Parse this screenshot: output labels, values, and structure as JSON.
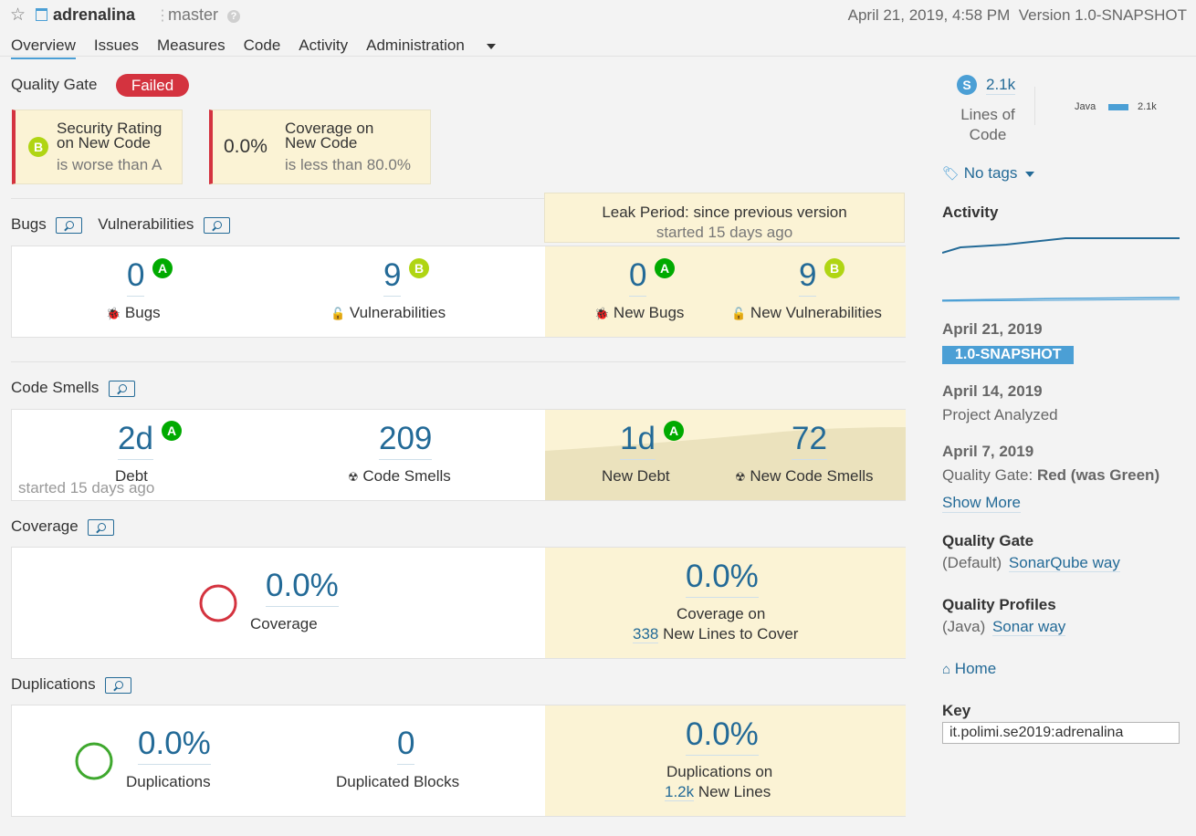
{
  "header": {
    "project_name": "adrenalina",
    "branch": "master",
    "help_glyph": "?",
    "date": "April 21, 2019, 4:58 PM",
    "version": "Version 1.0-SNAPSHOT"
  },
  "nav": {
    "tabs": [
      "Overview",
      "Issues",
      "Measures",
      "Code",
      "Activity",
      "Administration"
    ]
  },
  "quality_gate": {
    "label": "Quality Gate",
    "status": "Failed",
    "conditions": [
      {
        "rating": "B",
        "title_line1": "Security Rating",
        "title_line2": "on New Code",
        "sub": "is worse than A"
      },
      {
        "value": "0.0%",
        "title_line1": "Coverage on",
        "title_line2": "New Code",
        "sub": "is less than 80.0%"
      }
    ]
  },
  "leak_period": {
    "title": "Leak Period: since previous version",
    "sub": "started 15 days ago"
  },
  "bugs_section": {
    "title_bugs": "Bugs",
    "title_vulns": "Vulnerabilities",
    "bugs": {
      "value": "0",
      "rating": "A",
      "label": "Bugs"
    },
    "vulns": {
      "value": "9",
      "rating": "B",
      "label": "Vulnerabilities"
    },
    "new_bugs": {
      "value": "0",
      "rating": "A",
      "label": "New Bugs"
    },
    "new_vulns": {
      "value": "9",
      "rating": "B",
      "label": "New Vulnerabilities"
    }
  },
  "smells_section": {
    "title": "Code Smells",
    "debt": {
      "value": "2d",
      "rating": "A",
      "label": "Debt",
      "sub": "started 15 days ago"
    },
    "smells": {
      "value": "209",
      "label": "Code Smells"
    },
    "new_debt": {
      "value": "1d",
      "rating": "A",
      "label": "New Debt"
    },
    "new_smells": {
      "value": "72",
      "label": "New Code Smells"
    }
  },
  "coverage_section": {
    "title": "Coverage",
    "coverage": {
      "value": "0.0%",
      "label": "Coverage"
    },
    "new_coverage": {
      "value": "0.0%",
      "label_line1": "Coverage on",
      "lines_value": "338",
      "lines_label": "New Lines to Cover"
    }
  },
  "duplications_section": {
    "title": "Duplications",
    "duplications": {
      "value": "0.0%",
      "label": "Duplications"
    },
    "blocks": {
      "value": "0",
      "label": "Duplicated Blocks"
    },
    "new_dup": {
      "value": "0.0%",
      "label_line1": "Duplications on",
      "lines_value": "1.2k",
      "lines_label": "New Lines"
    }
  },
  "sidebar": {
    "size_badge": "S",
    "loc_value": "2.1k",
    "loc_label_line1": "Lines of",
    "loc_label_line2": "Code",
    "lang_name": "Java",
    "lang_value": "2.1k",
    "tags": "No tags",
    "activity_title": "Activity",
    "events": [
      {
        "date": "April 21, 2019",
        "badge": "1.0-SNAPSHOT"
      },
      {
        "date": "April 14, 2019",
        "text": "Project Analyzed"
      },
      {
        "date": "April 7, 2019",
        "prefix": "Quality Gate:",
        "text": "Red (was Green)"
      }
    ],
    "show_more": "Show More",
    "qg_title": "Quality Gate",
    "qg_default": "(Default)",
    "qg_link": "SonarQube way",
    "qp_title": "Quality Profiles",
    "qp_lang": "(Java)",
    "qp_link": "Sonar way",
    "home": "Home",
    "key_title": "Key",
    "key_value": "it.polimi.se2019:adrenalina"
  },
  "colors": {
    "accent": "#236a97",
    "failed": "#d4333f",
    "leak_bg": "#fbf3d5",
    "rating_A": "#00aa00",
    "rating_B": "#b0d513"
  }
}
